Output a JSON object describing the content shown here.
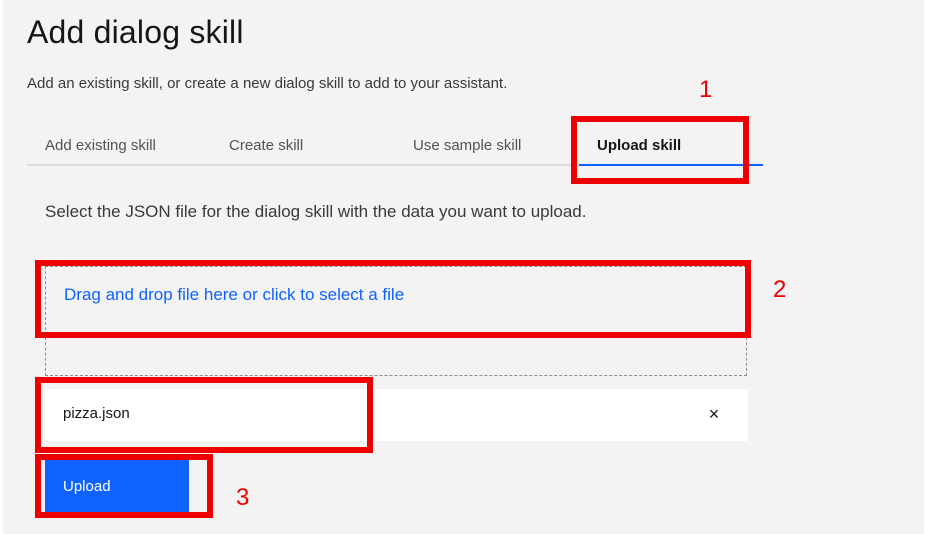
{
  "header": {
    "title": "Add dialog skill",
    "subtitle": "Add an existing skill, or create a new dialog skill to add to your assistant."
  },
  "tabs": [
    {
      "label": "Add existing skill"
    },
    {
      "label": "Create skill"
    },
    {
      "label": "Use sample skill"
    },
    {
      "label": "Upload skill",
      "active": true
    }
  ],
  "upload": {
    "description": "Select the JSON file for the dialog skill with the data you want to upload.",
    "dropzone_label": "Drag and drop file here or click to select a file",
    "file": {
      "name": "pizza.json",
      "remove_icon": "×"
    },
    "button_label": "Upload"
  },
  "annotations": [
    {
      "label": "1"
    },
    {
      "label": "2"
    },
    {
      "label": "3"
    }
  ],
  "colors": {
    "accent": "#0f62fe",
    "highlight": "#ee0000",
    "panel_bg": "#f3f3f3"
  }
}
